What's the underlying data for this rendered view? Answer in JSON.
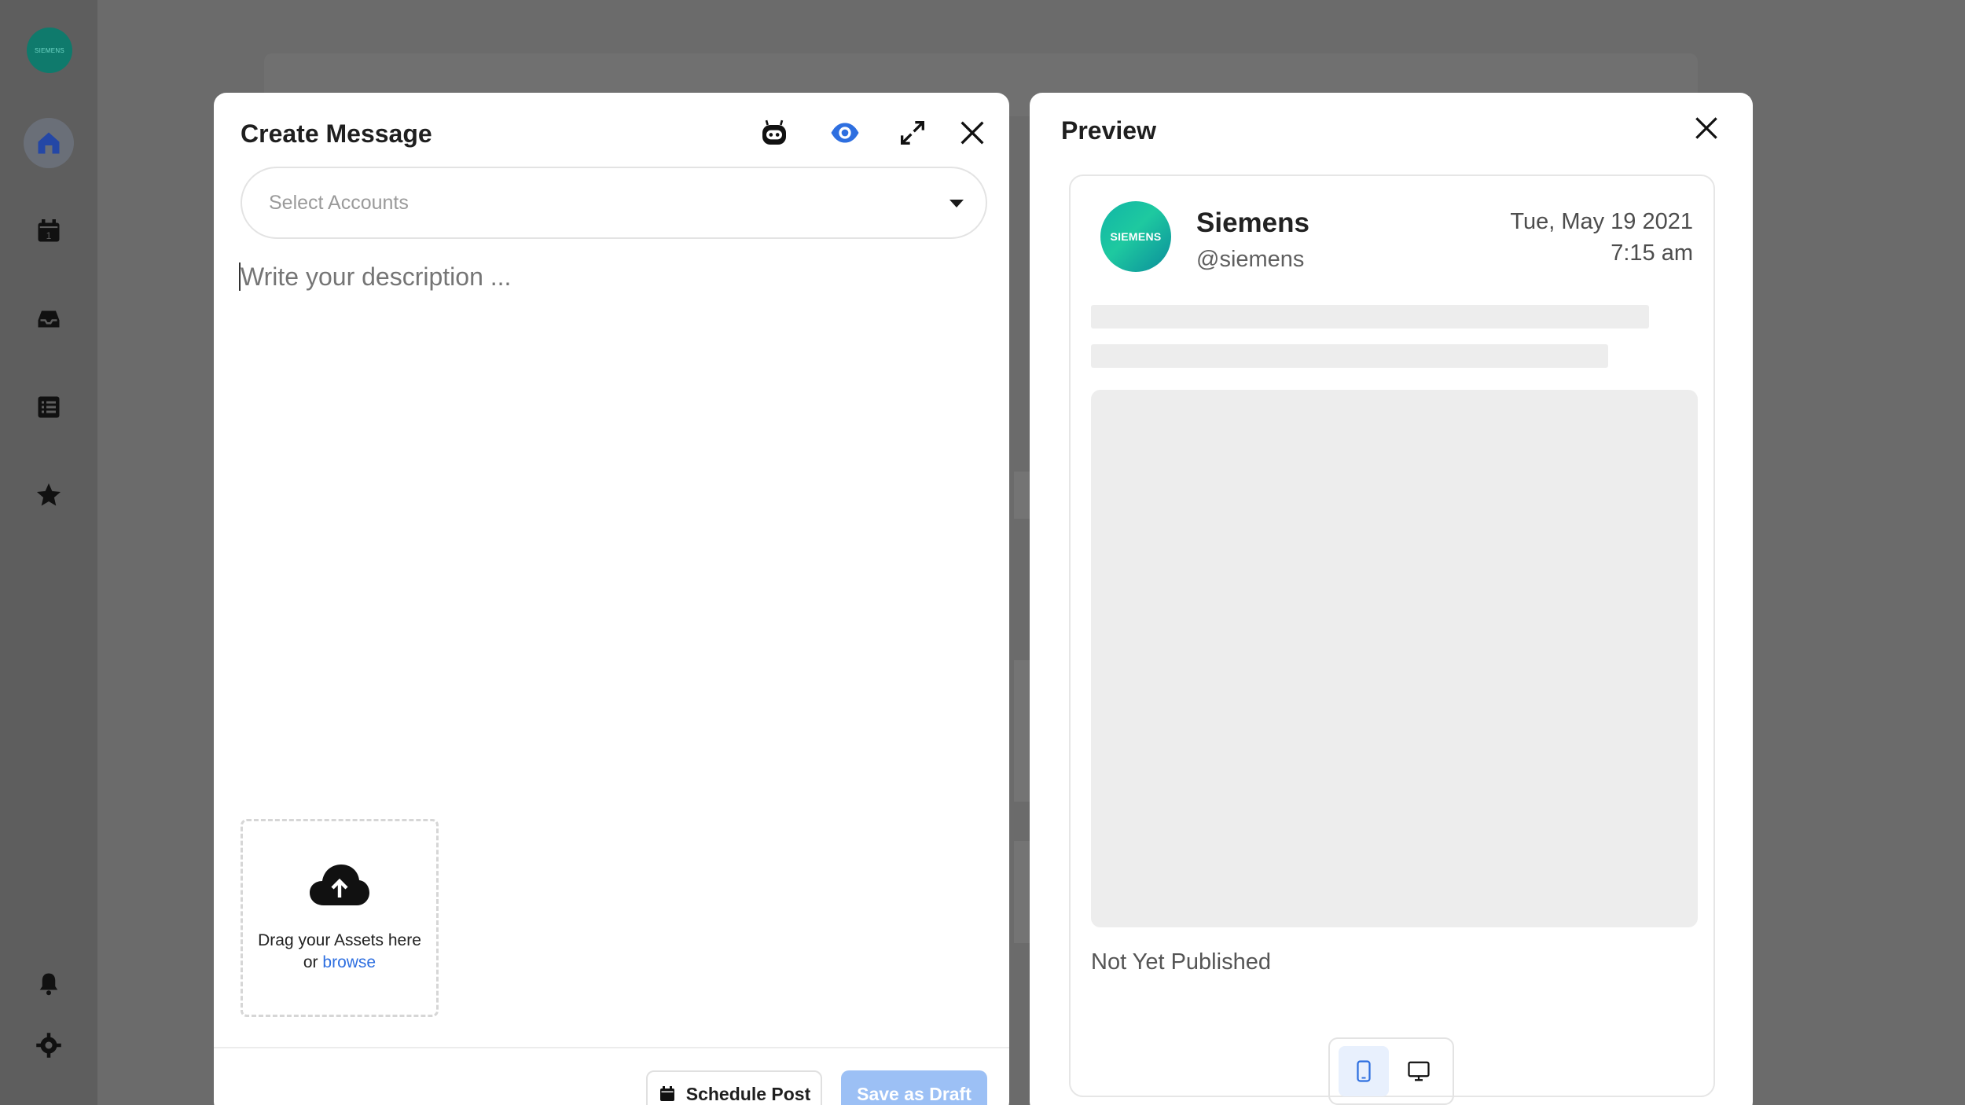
{
  "sidebar": {
    "logo_text": "SIEMENS",
    "items": [
      {
        "icon": "home-icon"
      },
      {
        "icon": "calendar-icon"
      },
      {
        "icon": "inbox-icon"
      },
      {
        "icon": "list-icon"
      },
      {
        "icon": "star-icon"
      },
      {
        "icon": "bell-icon"
      },
      {
        "icon": "gear-icon"
      }
    ]
  },
  "create_message": {
    "title": "Create Message",
    "header_icons": [
      "bot-icon",
      "eye-icon",
      "expand-icon",
      "close-icon"
    ],
    "select_accounts_placeholder": "Select Accounts",
    "description_placeholder": "Write your description ...",
    "dropzone": {
      "text": "Drag your Assets here",
      "or": "or",
      "link": "browse"
    },
    "schedule_button": "Schedule Post",
    "draft_button": "Save as Draft"
  },
  "preview": {
    "title": "Preview",
    "post": {
      "avatar_text": "SIEMENS",
      "name": "Siemens",
      "handle": "@siemens",
      "date": "Tue, May 19 2021",
      "time": "7:15 am",
      "status": "Not Yet Published"
    },
    "device_options": [
      "mobile-icon",
      "desktop-icon"
    ],
    "active_device": "mobile-icon"
  },
  "colors": {
    "accent": "#2e6fe0",
    "draft_button": "#9cc0f5",
    "overlay": "#6b6b6b",
    "brand_teal": "#11b5a6"
  }
}
